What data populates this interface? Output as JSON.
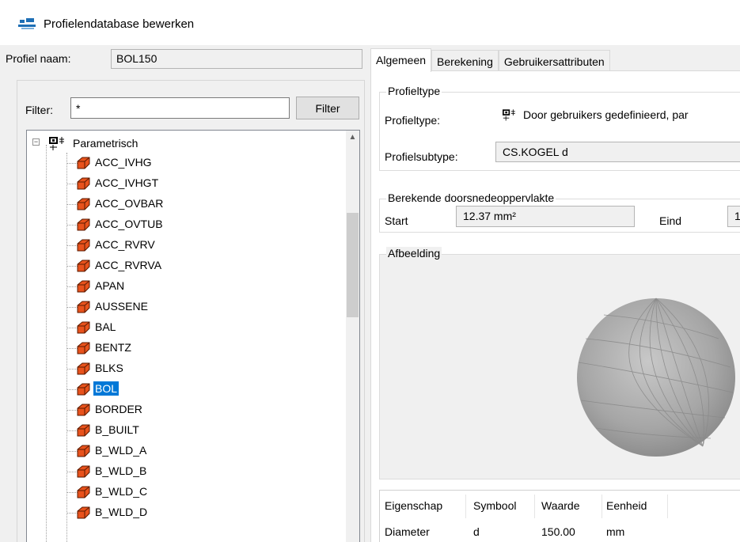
{
  "window": {
    "title": "Profielendatabase bewerken"
  },
  "profile_name": {
    "label": "Profiel naam:",
    "value": "BOL150"
  },
  "filter": {
    "label": "Filter:",
    "value": "*",
    "button": "Filter"
  },
  "tree": {
    "root_label": "Parametrisch",
    "items": [
      {
        "label": "ACC_IVHG",
        "selected": false
      },
      {
        "label": "ACC_IVHGT",
        "selected": false
      },
      {
        "label": "ACC_OVBAR",
        "selected": false
      },
      {
        "label": "ACC_OVTUB",
        "selected": false
      },
      {
        "label": "ACC_RVRV",
        "selected": false
      },
      {
        "label": "ACC_RVRVA",
        "selected": false
      },
      {
        "label": "APAN",
        "selected": false
      },
      {
        "label": "AUSSENE",
        "selected": false
      },
      {
        "label": "BAL",
        "selected": false
      },
      {
        "label": "BENTZ",
        "selected": false
      },
      {
        "label": "BLKS",
        "selected": false
      },
      {
        "label": "BOL",
        "selected": true
      },
      {
        "label": "BORDER",
        "selected": false
      },
      {
        "label": "B_BUILT",
        "selected": false
      },
      {
        "label": "B_WLD_A",
        "selected": false
      },
      {
        "label": "B_WLD_B",
        "selected": false
      },
      {
        "label": "B_WLD_C",
        "selected": false
      },
      {
        "label": "B_WLD_D",
        "selected": false
      }
    ]
  },
  "tabs": [
    {
      "label": "Algemeen",
      "active": true
    },
    {
      "label": "Berekening",
      "active": false
    },
    {
      "label": "Gebruikersattributen",
      "active": false
    }
  ],
  "profieltype_group": {
    "title": "Profieltype",
    "type_label": "Profieltype:",
    "type_value": "Door gebruikers gedefinieerd, par",
    "subtype_label": "Profielsubtype:",
    "subtype_value": "CS.KOGEL d"
  },
  "area_group": {
    "title": "Berekende doorsnedeoppervlakte",
    "start_label": "Start",
    "start_value": "12.37 mm²",
    "end_label": "Eind",
    "end_value": "1"
  },
  "image_group": {
    "title": "Afbeelding"
  },
  "properties": {
    "headers": [
      "Eigenschap",
      "Symbool",
      "Waarde",
      "Eenheid"
    ],
    "rows": [
      [
        "Diameter",
        "d",
        "150.00",
        "mm"
      ]
    ]
  },
  "colors": {
    "selection": "#0078d7",
    "profile_icon": "#e8521c",
    "app_icon": "#1e6fb5"
  }
}
